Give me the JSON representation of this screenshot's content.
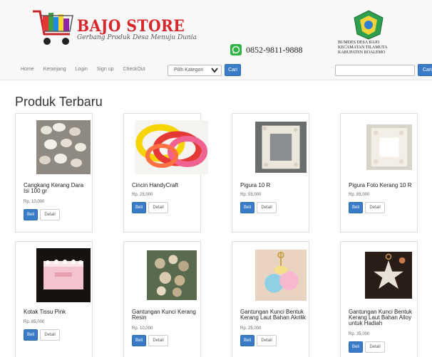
{
  "header": {
    "brand": "BAJO STORE",
    "tagline": "Gerbang Produk Desa Menuju Dunia",
    "phone": "0852-9811-9888",
    "org_line1": "BUMDES DESA BAJO",
    "org_line2": "KECAMATAN TILAMUTA",
    "org_line3": "KABUPATEN BOALEMO"
  },
  "nav": {
    "items": [
      "Home",
      "Keranjang",
      "Login",
      "Sign up",
      "CheckOut"
    ],
    "category_placeholder": "Pilih Kategori",
    "search_button": "Cari",
    "search_button_2": "Cari"
  },
  "main": {
    "title": "Produk Terbaru",
    "buy_label": "Beli",
    "detail_label": "Detail",
    "products": [
      {
        "name": "Cangkang Kerang Dara Isi 100 gr",
        "price": "Rp. 10,000"
      },
      {
        "name": "Cincin HandyCraft",
        "price": "Rp. 25,000"
      },
      {
        "name": "Pigura 10 R",
        "price": "Rp. 55,000"
      },
      {
        "name": "Pigura Foto Kerang 10 R",
        "price": "Rp. 85,000"
      },
      {
        "name": "Kotak Tissu Pink",
        "price": "Rp. 85,000"
      },
      {
        "name": "Gantungan Kunci Kerang Resin",
        "price": "Rp. 10,000"
      },
      {
        "name": "Gantungan Kunci Bentuk Kerang Laut Bahan Akrilik",
        "price": "Rp. 25,000"
      },
      {
        "name": "Gantungan Kunci Bentuk Kerang Laut Bahan Alloy untuk Hadiah",
        "price": "Rp. 35,000"
      }
    ]
  },
  "colors": {
    "brand_red": "#d8262b",
    "primary_blue": "#3a7bc8"
  }
}
